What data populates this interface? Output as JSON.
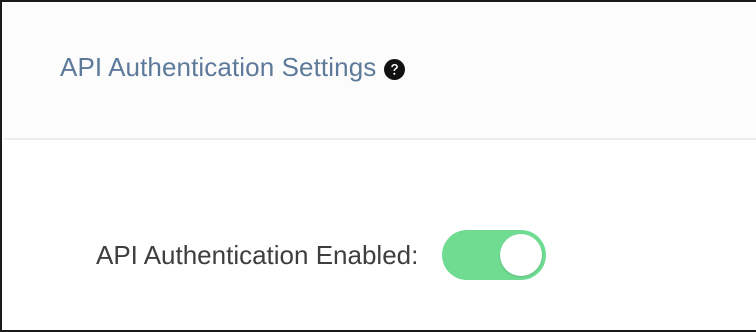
{
  "header": {
    "title": "API Authentication Settings",
    "help_icon": "question-circle-icon"
  },
  "settings": {
    "api_auth": {
      "label": "API Authentication Enabled:",
      "enabled": true,
      "toggle_color": "#6fdc92"
    }
  },
  "colors": {
    "title": "#5d7a9a",
    "label": "#3e3e3e",
    "toggle_on": "#6fdc92"
  }
}
